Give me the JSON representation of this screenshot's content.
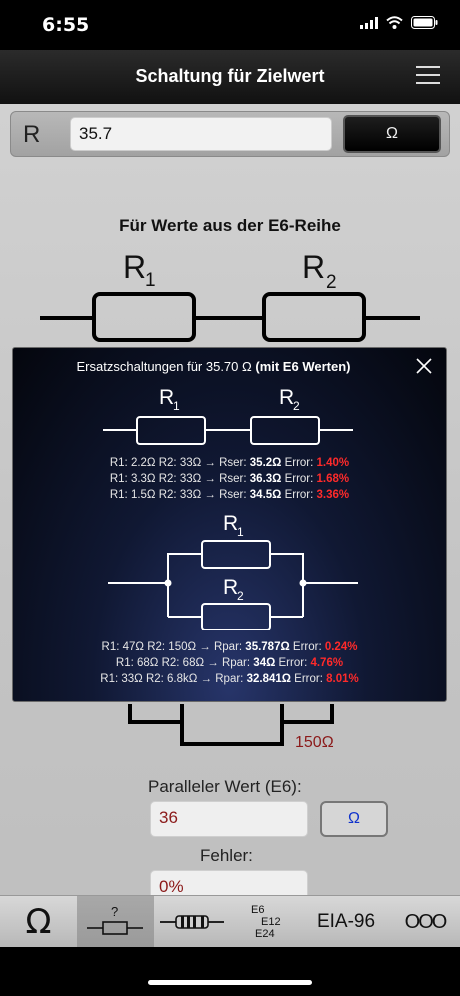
{
  "status_bar": {
    "time": "6:55"
  },
  "nav": {
    "title": "Schaltung für Zielwert"
  },
  "input": {
    "label": "R",
    "value": "35.7",
    "unit_button": "Ω"
  },
  "section": {
    "heading": "Für Werte aus der E6-Reihe"
  },
  "background_diagram": {
    "r1": "R",
    "r1_sub": "1",
    "r2": "R",
    "r2_sub": "2",
    "r2_value": "150Ω"
  },
  "popup": {
    "title_prefix": "Ersatzschaltungen für 35.70 Ω",
    "title_suffix": "(mit E6 Werten)",
    "series_diagram": {
      "r1": "R",
      "r1_sub": "1",
      "r2": "R",
      "r2_sub": "2"
    },
    "series_results": [
      {
        "text": "R1: 2.2Ω R2: 33Ω → Rser: ",
        "value": "35.2Ω",
        "error_label": " Error: ",
        "error": "1.40%"
      },
      {
        "text": "R1: 3.3Ω R2: 33Ω → Rser: ",
        "value": "36.3Ω",
        "error_label": " Error: ",
        "error": "1.68%"
      },
      {
        "text": "R1: 1.5Ω R2: 33Ω → Rser: ",
        "value": "34.5Ω",
        "error_label": " Error: ",
        "error": "3.36%"
      }
    ],
    "parallel_diagram": {
      "r1": "R",
      "r1_sub": "1",
      "r2": "R",
      "r2_sub": "2"
    },
    "parallel_results": [
      {
        "text": "R1: 47Ω R2: 150Ω → Rpar: ",
        "value": "35.787Ω",
        "error_label": " Error: ",
        "error": "0.24%"
      },
      {
        "text": "R1: 68Ω R2: 68Ω → Rpar: ",
        "value": "34Ω",
        "error_label": " Error: ",
        "error": "4.76%"
      },
      {
        "text": "R1: 33Ω R2: 6.8kΩ → Rpar: ",
        "value": "32.841Ω",
        "error_label": " Error: ",
        "error": "8.01%"
      }
    ]
  },
  "parallel": {
    "label": "Paralleler Wert (E6):",
    "value": "36",
    "unit_button": "Ω"
  },
  "error": {
    "label": "Fehler:",
    "value": "0%"
  },
  "tabs": {
    "ohm": "Ω",
    "target_question": "?",
    "series_line1": "E6",
    "series_line2": "E12",
    "series_line3": "E24",
    "eia": "EIA-96",
    "more": "OOO"
  },
  "colors": {
    "error_red": "#ff2a2a",
    "value_dark_red": "#8b1a1a",
    "link_blue": "#1133cc"
  }
}
